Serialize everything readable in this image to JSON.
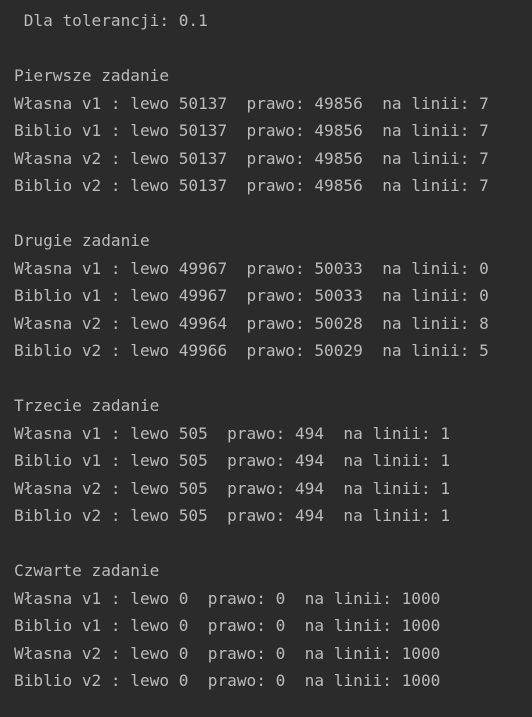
{
  "colors": {
    "background": "#2b2b2b",
    "text": "#bbbbbb"
  },
  "console": {
    "header": " Dla tolerancji: 0.1",
    "sections": [
      {
        "title": "Pierwsze zadanie",
        "rows": [
          "Własna v1 : lewo 50137  prawo: 49856  na linii: 7",
          "Biblio v1 : lewo 50137  prawo: 49856  na linii: 7",
          "Własna v2 : lewo 50137  prawo: 49856  na linii: 7",
          "Biblio v2 : lewo 50137  prawo: 49856  na linii: 7"
        ]
      },
      {
        "title": "Drugie zadanie",
        "rows": [
          "Własna v1 : lewo 49967  prawo: 50033  na linii: 0",
          "Biblio v1 : lewo 49967  prawo: 50033  na linii: 0",
          "Własna v2 : lewo 49964  prawo: 50028  na linii: 8",
          "Biblio v2 : lewo 49966  prawo: 50029  na linii: 5"
        ]
      },
      {
        "title": "Trzecie zadanie",
        "rows": [
          "Własna v1 : lewo 505  prawo: 494  na linii: 1",
          "Biblio v1 : lewo 505  prawo: 494  na linii: 1",
          "Własna v2 : lewo 505  prawo: 494  na linii: 1",
          "Biblio v2 : lewo 505  prawo: 494  na linii: 1"
        ]
      },
      {
        "title": "Czwarte zadanie",
        "rows": [
          "Własna v1 : lewo 0  prawo: 0  na linii: 1000",
          "Biblio v1 : lewo 0  prawo: 0  na linii: 1000",
          "Własna v2 : lewo 0  prawo: 0  na linii: 1000",
          "Biblio v2 : lewo 0  prawo: 0  na linii: 1000"
        ]
      }
    ]
  }
}
